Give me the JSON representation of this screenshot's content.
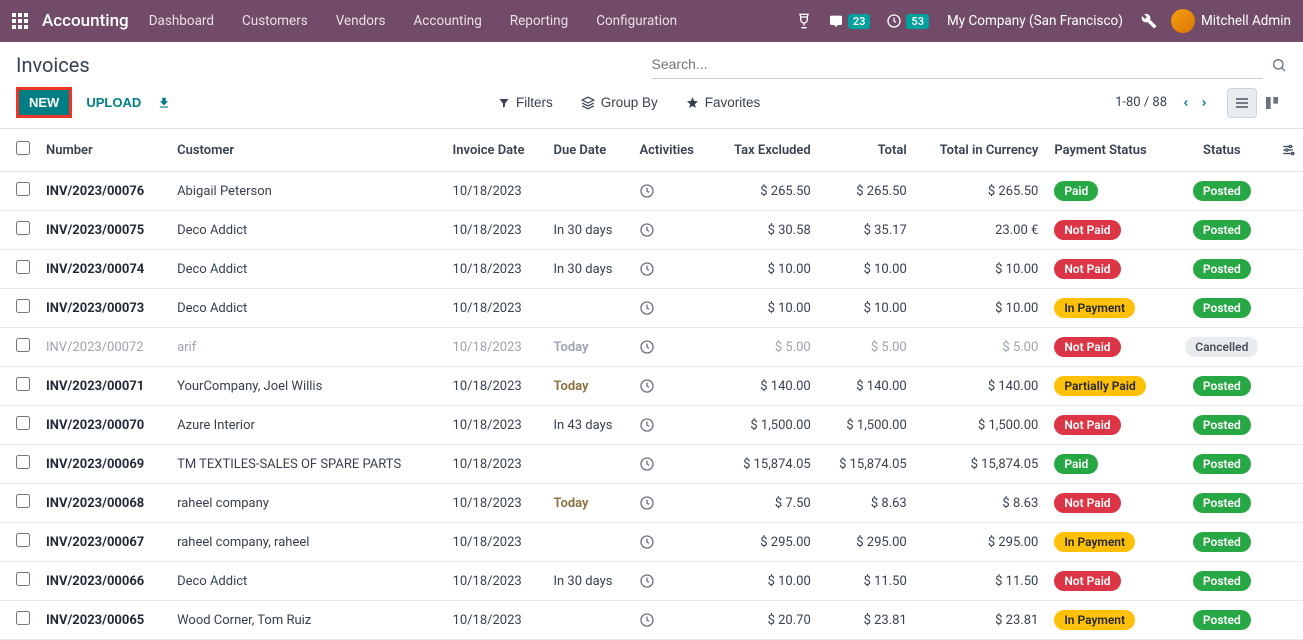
{
  "topnav": {
    "brand": "Accounting",
    "menu": [
      "Dashboard",
      "Customers",
      "Vendors",
      "Accounting",
      "Reporting",
      "Configuration"
    ],
    "chat_badge": "23",
    "clock_badge": "53",
    "company": "My Company (San Francisco)",
    "user": "Mitchell Admin"
  },
  "page": {
    "title": "Invoices",
    "search_placeholder": "Search...",
    "new_label": "NEW",
    "upload_label": "UPLOAD",
    "filters_label": "Filters",
    "groupby_label": "Group By",
    "favorites_label": "Favorites",
    "pager": "1-80 / 88"
  },
  "columns": {
    "number": "Number",
    "customer": "Customer",
    "invoice_date": "Invoice Date",
    "due_date": "Due Date",
    "activities": "Activities",
    "tax_excluded": "Tax Excluded",
    "total": "Total",
    "total_currency": "Total in Currency",
    "payment_status": "Payment Status",
    "status": "Status"
  },
  "rows": [
    {
      "number": "INV/2023/00076",
      "customer": "Abigail Peterson",
      "date": "10/18/2023",
      "due": "",
      "tax": "$ 265.50",
      "total": "$ 265.50",
      "totcur": "$ 265.50",
      "pay": "Paid",
      "status": "Posted"
    },
    {
      "number": "INV/2023/00075",
      "customer": "Deco Addict",
      "date": "10/18/2023",
      "due": "In 30 days",
      "tax": "$ 30.58",
      "total": "$ 35.17",
      "totcur": "23.00 €",
      "pay": "Not Paid",
      "status": "Posted"
    },
    {
      "number": "INV/2023/00074",
      "customer": "Deco Addict",
      "date": "10/18/2023",
      "due": "In 30 days",
      "tax": "$ 10.00",
      "total": "$ 10.00",
      "totcur": "$ 10.00",
      "pay": "Not Paid",
      "status": "Posted"
    },
    {
      "number": "INV/2023/00073",
      "customer": "Deco Addict",
      "date": "10/18/2023",
      "due": "",
      "tax": "$ 10.00",
      "total": "$ 10.00",
      "totcur": "$ 10.00",
      "pay": "In Payment",
      "status": "Posted"
    },
    {
      "number": "INV/2023/00072",
      "customer": "arif",
      "date": "10/18/2023",
      "due": "Today",
      "tax": "$ 5.00",
      "total": "$ 5.00",
      "totcur": "$ 5.00",
      "pay": "Not Paid",
      "status": "Cancelled"
    },
    {
      "number": "INV/2023/00071",
      "customer": "YourCompany, Joel Willis",
      "date": "10/18/2023",
      "due": "Today",
      "tax": "$ 140.00",
      "total": "$ 140.00",
      "totcur": "$ 140.00",
      "pay": "Partially Paid",
      "status": "Posted"
    },
    {
      "number": "INV/2023/00070",
      "customer": "Azure Interior",
      "date": "10/18/2023",
      "due": "In 43 days",
      "tax": "$ 1,500.00",
      "total": "$ 1,500.00",
      "totcur": "$ 1,500.00",
      "pay": "Not Paid",
      "status": "Posted"
    },
    {
      "number": "INV/2023/00069",
      "customer": "TM TEXTILES-SALES OF SPARE PARTS",
      "date": "10/18/2023",
      "due": "",
      "tax": "$ 15,874.05",
      "total": "$ 15,874.05",
      "totcur": "$ 15,874.05",
      "pay": "Paid",
      "status": "Posted"
    },
    {
      "number": "INV/2023/00068",
      "customer": "raheel company",
      "date": "10/18/2023",
      "due": "Today",
      "tax": "$ 7.50",
      "total": "$ 8.63",
      "totcur": "$ 8.63",
      "pay": "Not Paid",
      "status": "Posted"
    },
    {
      "number": "INV/2023/00067",
      "customer": "raheel company, raheel",
      "date": "10/18/2023",
      "due": "",
      "tax": "$ 295.00",
      "total": "$ 295.00",
      "totcur": "$ 295.00",
      "pay": "In Payment",
      "status": "Posted"
    },
    {
      "number": "INV/2023/00066",
      "customer": "Deco Addict",
      "date": "10/18/2023",
      "due": "In 30 days",
      "tax": "$ 10.00",
      "total": "$ 11.50",
      "totcur": "$ 11.50",
      "pay": "Not Paid",
      "status": "Posted"
    },
    {
      "number": "INV/2023/00065",
      "customer": "Wood Corner, Tom Ruiz",
      "date": "10/18/2023",
      "due": "",
      "tax": "$ 20.70",
      "total": "$ 23.81",
      "totcur": "$ 23.81",
      "pay": "In Payment",
      "status": "Posted"
    }
  ]
}
